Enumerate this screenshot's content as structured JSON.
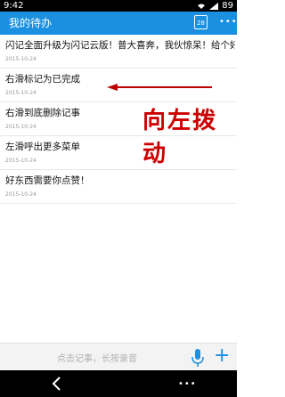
{
  "status_bar": {
    "time": "9:42",
    "battery": "89"
  },
  "app_bar": {
    "title": "我的待办",
    "calendar_day": "28",
    "more": "•••"
  },
  "todos": [
    {
      "text": "闪记全面升级为闪记云版！普大喜奔，我伙惊呆！给个好评",
      "date": "2015-10-24"
    },
    {
      "text": "右滑标记为已完成",
      "date": "2015-10-24"
    },
    {
      "text": "右滑到底删除记事",
      "date": "2015-10-24"
    },
    {
      "text": "左滑呼出更多菜单",
      "date": "2015-10-24"
    },
    {
      "text": "好东西需要你点赞！",
      "date": "2015-10-24"
    }
  ],
  "annotation": {
    "text": "向左拨动",
    "color": "#cc0000"
  },
  "input_bar": {
    "placeholder": "点击记事，长按录音"
  },
  "accent_color": "#1b8fe0",
  "icons": {
    "wifi": "wifi-icon",
    "signal": "signal-icon",
    "calendar": "calendar-icon",
    "mic": "mic-icon",
    "plus": "plus-icon",
    "back": "back-icon"
  }
}
